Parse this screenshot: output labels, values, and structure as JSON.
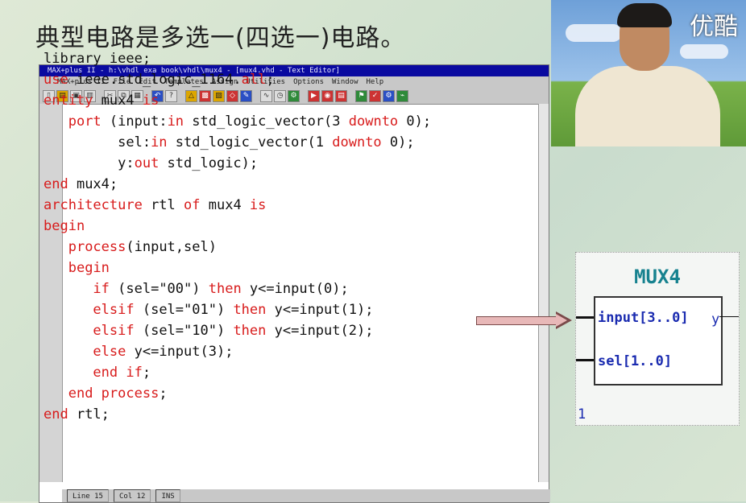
{
  "slide": {
    "title": "典型电路是多选一(四选一)电路。"
  },
  "window": {
    "title": "MAX+plus II - h:\\vhdl exa book\\vhdl\\mux4 - [mux4.vhd - Text Editor]",
    "menu": [
      "MAX+plus II",
      "File",
      "Edit",
      "Templates",
      "Assign",
      "Utilities",
      "Options",
      "Window",
      "Help"
    ],
    "status": {
      "line": "Line 15",
      "col": "Col 12",
      "mode": "INS"
    }
  },
  "code": {
    "lines": [
      [
        {
          "t": "library ieee;"
        }
      ],
      [
        {
          "t": "use",
          "k": 1
        },
        {
          "t": " ieee.std_logic_1164."
        },
        {
          "t": "all",
          "k": 1
        },
        {
          "t": ";"
        }
      ],
      [
        {
          "t": "entity",
          "k": 1
        },
        {
          "t": " mux4 "
        },
        {
          "t": "is",
          "k": 1
        }
      ],
      [
        {
          "t": "   "
        },
        {
          "t": "port",
          "k": 1
        },
        {
          "t": " (input:"
        },
        {
          "t": "in",
          "k": 1
        },
        {
          "t": " std_logic_vector(3 "
        },
        {
          "t": "downto",
          "k": 1
        },
        {
          "t": " 0);"
        }
      ],
      [
        {
          "t": "         sel:"
        },
        {
          "t": "in",
          "k": 1
        },
        {
          "t": " std_logic_vector(1 "
        },
        {
          "t": "downto",
          "k": 1
        },
        {
          "t": " 0);"
        }
      ],
      [
        {
          "t": "         y:"
        },
        {
          "t": "out",
          "k": 1
        },
        {
          "t": " std_logic);"
        }
      ],
      [
        {
          "t": "end",
          "k": 1
        },
        {
          "t": " mux4;"
        }
      ],
      [
        {
          "t": "architecture",
          "k": 1
        },
        {
          "t": " rtl "
        },
        {
          "t": "of",
          "k": 1
        },
        {
          "t": " mux4 "
        },
        {
          "t": "is",
          "k": 1
        }
      ],
      [
        {
          "t": "begin",
          "k": 1
        }
      ],
      [
        {
          "t": "   "
        },
        {
          "t": "process",
          "k": 1
        },
        {
          "t": "(input,sel)"
        }
      ],
      [
        {
          "t": "   "
        },
        {
          "t": "begin",
          "k": 1
        }
      ],
      [
        {
          "t": "      "
        },
        {
          "t": "if",
          "k": 1
        },
        {
          "t": " (sel=\"00\") "
        },
        {
          "t": "then",
          "k": 1
        },
        {
          "t": " y<=input(0);"
        }
      ],
      [
        {
          "t": "      "
        },
        {
          "t": "elsif",
          "k": 1
        },
        {
          "t": " (sel=\"01\") "
        },
        {
          "t": "then",
          "k": 1
        },
        {
          "t": " y<=input(1);"
        }
      ],
      [
        {
          "t": "      "
        },
        {
          "t": "elsif",
          "k": 1
        },
        {
          "t": " (sel=\"10\") "
        },
        {
          "t": "then",
          "k": 1
        },
        {
          "t": " y<=input(2);"
        }
      ],
      [
        {
          "t": "      "
        },
        {
          "t": "else",
          "k": 1
        },
        {
          "t": " y<=input(3);"
        }
      ],
      [
        {
          "t": "      "
        },
        {
          "t": "end if",
          "k": 1
        },
        {
          "t": ";"
        }
      ],
      [
        {
          "t": "   "
        },
        {
          "t": "end process",
          "k": 1
        },
        {
          "t": ";"
        }
      ],
      [
        {
          "t": "end",
          "k": 1
        },
        {
          "t": " rtl;"
        }
      ]
    ]
  },
  "video": {
    "logo": "优酷"
  },
  "mux": {
    "title": "MUX4",
    "input_label": "input[3..0]",
    "sel_label": "sel[1..0]",
    "output_label": "y",
    "extra_label": "1"
  }
}
